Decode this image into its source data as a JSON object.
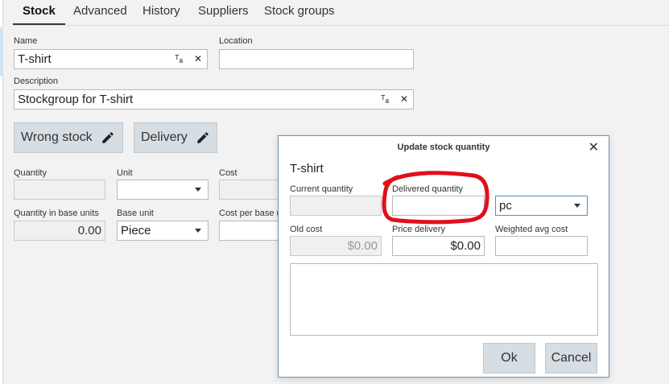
{
  "tabs": [
    {
      "label": "Stock",
      "active": true
    },
    {
      "label": "Advanced"
    },
    {
      "label": "History"
    },
    {
      "label": "Suppliers"
    },
    {
      "label": "Stock groups"
    }
  ],
  "form": {
    "name_label": "Name",
    "name_value": "T-shirt",
    "location_label": "Location",
    "location_value": "",
    "description_label": "Description",
    "description_value": "Stockgroup for T-shirt",
    "translate_glyph": "ᵀₐ",
    "clear_glyph": "✕",
    "wrong_stock_label": "Wrong stock",
    "delivery_label": "Delivery",
    "quantity_label": "Quantity",
    "unit_label": "Unit",
    "cost_label": "Cost",
    "qty_base_label": "Quantity in base units",
    "qty_base_value": "0.00",
    "base_unit_label": "Base unit",
    "base_unit_value": "Piece",
    "cost_base_label": "Cost per base u"
  },
  "dialog": {
    "title": "Update stock quantity",
    "close_glyph": "✕",
    "heading": "T-shirt",
    "current_qty_label": "Current quantity",
    "delivered_qty_label": "Delivered quantity",
    "unit_value": "pc",
    "old_cost_label": "Old cost",
    "old_cost_value": "$0.00",
    "price_delivery_label": "Price delivery",
    "price_delivery_value": "$0.00",
    "weighted_avg_label": "Weighted avg cost",
    "ok_label": "Ok",
    "cancel_label": "Cancel"
  },
  "colors": {
    "annotation": "#e0101b",
    "dialog_border": "#6b93b6",
    "button_bg": "#d6dde3"
  }
}
